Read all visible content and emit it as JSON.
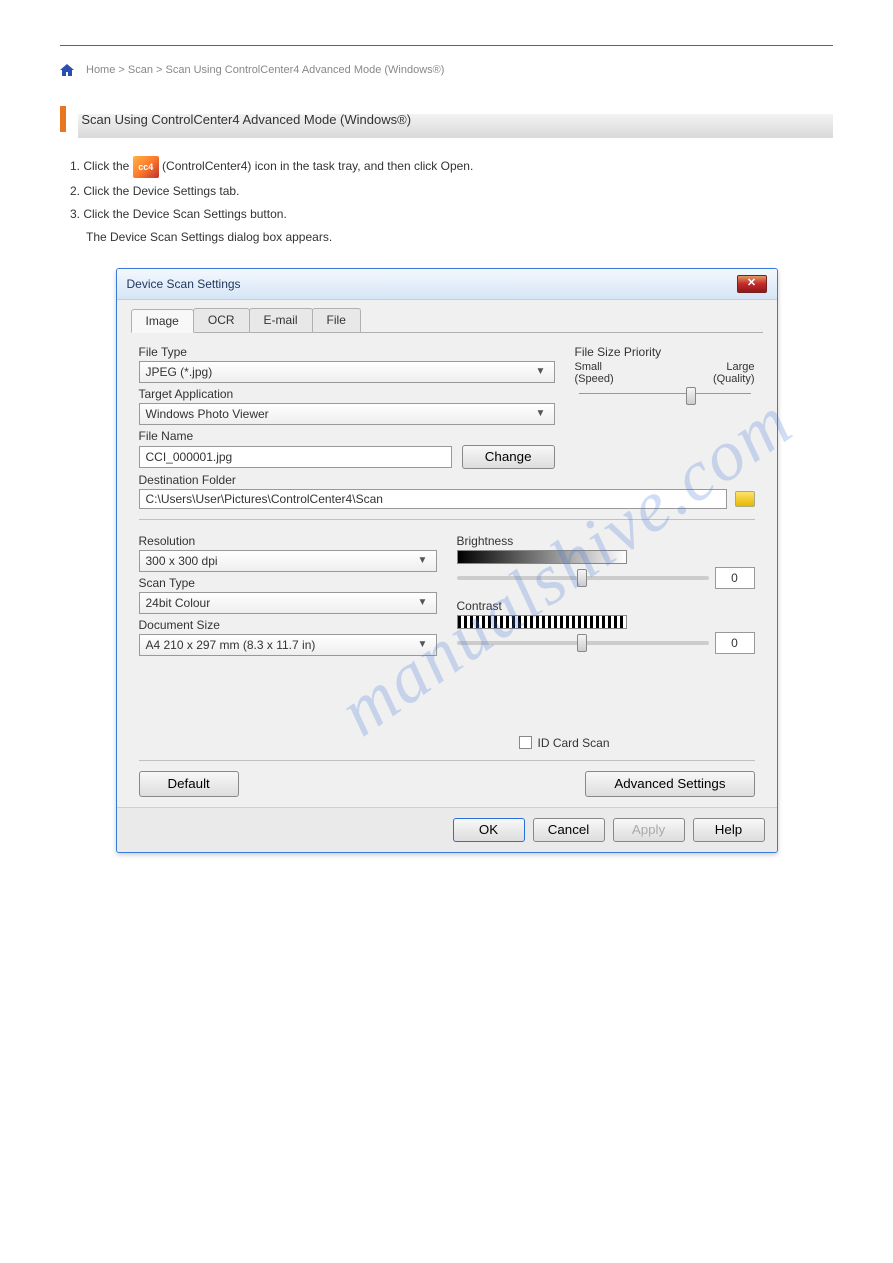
{
  "breadcrumb": "Home > Scan > Scan Using ControlCenter4 Advanced Mode (Windows®)",
  "page_title": "Scan Using ControlCenter4 Advanced Mode (Windows®)",
  "steps": {
    "s1": "1. Click the",
    "s1b": "(ControlCenter4) icon in the task tray, and then click Open.",
    "s2": "2. Click the Device Settings tab.",
    "s3": "3. Click the Device Scan Settings button.",
    "s3b": "The Device Scan Settings dialog box appears."
  },
  "dialog": {
    "title": "Device Scan Settings",
    "tabs": [
      "Image",
      "OCR",
      "E-mail",
      "File"
    ],
    "labels": {
      "file_type": "File Type",
      "target_app": "Target Application",
      "file_name": "File Name",
      "dest_folder": "Destination Folder",
      "resolution": "Resolution",
      "scan_type": "Scan Type",
      "doc_size": "Document Size",
      "fsp": "File Size Priority",
      "small": "Small",
      "large": "Large",
      "speed": "(Speed)",
      "quality": "(Quality)",
      "brightness": "Brightness",
      "contrast": "Contrast",
      "id_card": "ID Card Scan"
    },
    "values": {
      "file_type": "JPEG (*.jpg)",
      "target_app": "Windows Photo Viewer",
      "file_name": "CCI_000001.jpg",
      "dest_folder": "C:\\Users\\User\\Pictures\\ControlCenter4\\Scan",
      "resolution": "300 x 300 dpi",
      "scan_type": "24bit Colour",
      "doc_size": "A4 210 x 297 mm (8.3 x 11.7 in)",
      "brightness": "0",
      "contrast": "0"
    },
    "buttons": {
      "change": "Change",
      "default": "Default",
      "advanced": "Advanced Settings",
      "ok": "OK",
      "cancel": "Cancel",
      "apply": "Apply",
      "help": "Help"
    }
  },
  "watermark": "manualshive.com"
}
